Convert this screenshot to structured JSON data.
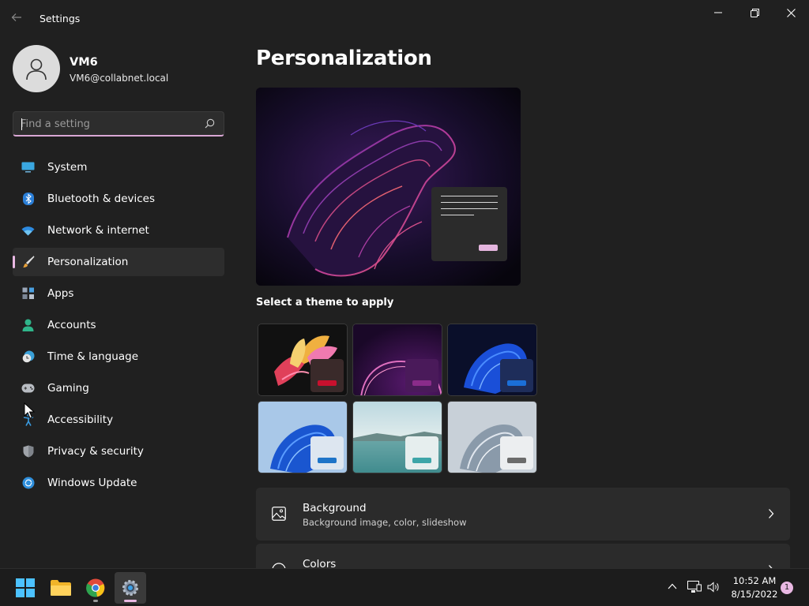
{
  "window": {
    "title": "Settings",
    "controls": [
      "minimize-icon",
      "restore-icon",
      "close-icon"
    ]
  },
  "user": {
    "name": "VM6",
    "email": "VM6@collabnet.local"
  },
  "search": {
    "placeholder": "Find a setting",
    "value": ""
  },
  "sidebar": {
    "items": [
      {
        "label": "System",
        "icon": "monitor-icon"
      },
      {
        "label": "Bluetooth & devices",
        "icon": "bluetooth-icon"
      },
      {
        "label": "Network & internet",
        "icon": "wifi-icon"
      },
      {
        "label": "Personalization",
        "icon": "brush-icon",
        "active": true
      },
      {
        "label": "Apps",
        "icon": "apps-icon"
      },
      {
        "label": "Accounts",
        "icon": "person-icon"
      },
      {
        "label": "Time & language",
        "icon": "clock-globe-icon"
      },
      {
        "label": "Gaming",
        "icon": "gamepad-icon"
      },
      {
        "label": "Accessibility",
        "icon": "accessibility-icon"
      },
      {
        "label": "Privacy & security",
        "icon": "shield-icon"
      },
      {
        "label": "Windows Update",
        "icon": "update-icon"
      }
    ]
  },
  "main": {
    "title": "Personalization",
    "theme_heading": "Select a theme to apply",
    "themes": [
      {
        "name": "glow-flower",
        "accent": "#c8102e"
      },
      {
        "name": "purple-eclipse",
        "accent": "#8a2c8a"
      },
      {
        "name": "blue-bloom-dark",
        "accent": "#1b6fd8"
      },
      {
        "name": "blue-bloom-light",
        "accent": "#1e74c8"
      },
      {
        "name": "lake-sunrise",
        "accent": "#3da5a8"
      },
      {
        "name": "silver-bloom",
        "accent": "#6b6b6b"
      }
    ],
    "cards": [
      {
        "title": "Background",
        "subtitle": "Background image, color, slideshow",
        "icon": "image-icon"
      },
      {
        "title": "Colors",
        "subtitle": "",
        "icon": "palette-icon"
      }
    ]
  },
  "colors": {
    "accent": "#e9b8e3",
    "window_bg": "#202020",
    "card_bg": "#2b2b2b"
  },
  "taskbar": {
    "apps": [
      "start-icon",
      "file-explorer-icon",
      "chrome-icon",
      "settings-icon"
    ],
    "time": "10:52 AM",
    "date": "8/15/2022",
    "notification_count": "1"
  }
}
